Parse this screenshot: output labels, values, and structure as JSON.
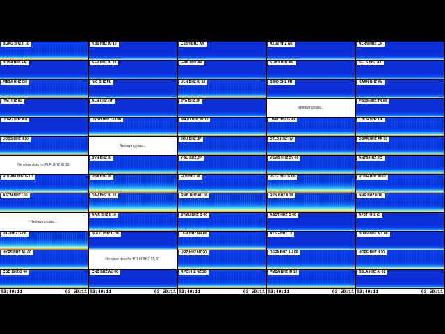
{
  "timestamps": {
    "start": "03:49:11",
    "end": "03:59:11"
  },
  "columns": [
    {
      "panels": [
        {
          "label": "BGKG BHZ II 10",
          "state": "data",
          "style": "normal"
        },
        {
          "label": "BOSA BHZ FM",
          "state": "data",
          "style": "calm"
        },
        {
          "label": "FIESA HHZ CH",
          "state": "data",
          "style": "normal"
        },
        {
          "label": "ITM HHZ HL",
          "state": "data",
          "style": "calm"
        },
        {
          "label": "DURG HHZ KO",
          "state": "data",
          "style": "calm"
        },
        {
          "label": "UOSS BHZ II 10",
          "state": "data",
          "style": "normal"
        },
        {
          "label": "",
          "state": "nodata",
          "message": "No wave data for FUR BHZ IU 10."
        },
        {
          "label": "ROCAM BHZ G 10",
          "state": "data",
          "style": "normal"
        },
        {
          "label": "ASCN BHZ I 00",
          "state": "data",
          "style": "normal"
        },
        {
          "label": "",
          "state": "loading",
          "message": "Retrieving data..."
        },
        {
          "label": "PAF BHZ G 00",
          "state": "data",
          "style": "hot"
        },
        {
          "label": "HKPS BHZ AU 00",
          "state": "data",
          "style": "normal"
        },
        {
          "label": "CGD BHZ G 00",
          "state": "data",
          "style": "normal"
        }
      ]
    },
    {
      "panels": [
        {
          "label": "KBS HHZ IU 10",
          "state": "data",
          "style": "calm"
        },
        {
          "label": "KEV BHZ IU 10",
          "state": "data",
          "style": "calm"
        },
        {
          "label": "NIC BHZ FL",
          "state": "data",
          "style": "calm"
        },
        {
          "label": "ALN HHZ HT",
          "state": "data",
          "style": "calm"
        },
        {
          "label": "DYNH HHZ GO 00",
          "state": "data",
          "style": "normal"
        },
        {
          "label": "",
          "state": "loading",
          "message": "Retrieving data..."
        },
        {
          "label": "SVN BHZ IU",
          "state": "data",
          "style": "normal"
        },
        {
          "label": "PBA HHZ IN",
          "state": "data",
          "style": "hot"
        },
        {
          "label": "DAV BHZ IU 10",
          "state": "data",
          "style": "hot"
        },
        {
          "label": "AIVR BHZ II 10",
          "state": "data",
          "style": "normal"
        },
        {
          "label": "NGUC HHZ G 00",
          "state": "data",
          "style": "calm"
        },
        {
          "label": "",
          "state": "nodata",
          "message": "No wave data for BTLM BHZ 20 00."
        },
        {
          "label": "CNB BHZ AU 00",
          "state": "data",
          "style": "calm"
        }
      ]
    },
    {
      "panels": [
        {
          "label": "C1BH BHZ AK",
          "state": "data",
          "style": "calm"
        },
        {
          "label": "GAN BHZ AV",
          "state": "data",
          "style": "calm"
        },
        {
          "label": "ULN BHZ IU 10",
          "state": "data",
          "style": "normal"
        },
        {
          "label": "JYA BHZ JP",
          "state": "data",
          "style": "calm"
        },
        {
          "label": "MAJO BHZ IU 10",
          "state": "data",
          "style": "normal"
        },
        {
          "label": "JOU BHZ JP",
          "state": "data",
          "style": "normal"
        },
        {
          "label": "YGU BHZ JP",
          "state": "data",
          "style": "normal"
        },
        {
          "label": "FLB BHZ MI",
          "state": "data",
          "style": "normal"
        },
        {
          "label": "RMB BHZ AU 00",
          "state": "data",
          "style": "hot"
        },
        {
          "label": "STMU BHZ G 00",
          "state": "data",
          "style": "normal"
        },
        {
          "label": "LEM HHZ NV 00",
          "state": "data",
          "style": "normal"
        },
        {
          "label": "URZ HHZ NZ 20",
          "state": "data",
          "style": "normal"
        },
        {
          "label": "RPZ HHZ NZ 20",
          "state": "data",
          "style": "normal"
        }
      ]
    },
    {
      "panels": [
        {
          "label": "A21N HHZ AK",
          "state": "data",
          "style": "calm"
        },
        {
          "label": "KOKV BHZ AV",
          "state": "data",
          "style": "calm"
        },
        {
          "label": "BB40 DHZ FB",
          "state": "data",
          "style": "calm"
        },
        {
          "label": "",
          "state": "loading",
          "message": "Retrieving data..."
        },
        {
          "label": "LINM HHZ G 00",
          "state": "data",
          "style": "normal"
        },
        {
          "label": "DTLD HHZ HV",
          "state": "data",
          "style": "normal"
        },
        {
          "label": "VSMG HHZ SV 00",
          "state": "data",
          "style": "normal"
        },
        {
          "label": "PFTF BHZ G 00",
          "state": "data",
          "style": "hot"
        },
        {
          "label": "RPN BHZ II 10",
          "state": "data",
          "style": "hot"
        },
        {
          "label": "AGST HHZ G 00",
          "state": "data",
          "style": "calm"
        },
        {
          "label": "AYSG HHZ CI",
          "state": "data",
          "style": "calm"
        },
        {
          "label": "DSPA BHZ AU 00",
          "state": "data",
          "style": "normal"
        },
        {
          "label": "PMSA BHZ IU 10",
          "state": "data",
          "style": "normal"
        }
      ]
    },
    {
      "panels": [
        {
          "label": "ALRN HHZ CN",
          "state": "data",
          "style": "calm"
        },
        {
          "label": "SELS BHZ AV",
          "state": "data",
          "style": "calm"
        },
        {
          "label": "KARN BHZ AV",
          "state": "data",
          "style": "calm"
        },
        {
          "label": "PBDS HHZ TX 00",
          "state": "data",
          "style": "calm"
        },
        {
          "label": "CHOR HHZ OK",
          "state": "data",
          "style": "normal"
        },
        {
          "label": "DBPR HHZ PR 00",
          "state": "data",
          "style": "normal"
        },
        {
          "label": "ANTS HHZ EC",
          "state": "data",
          "style": "normal"
        },
        {
          "label": "ROSR HHZ IU 02",
          "state": "data",
          "style": "normal"
        },
        {
          "label": "NNR BHZ II 10",
          "state": "data",
          "style": "normal"
        },
        {
          "label": "AP3T HHZ CI",
          "state": "data",
          "style": "calm"
        },
        {
          "label": "SOKV BHZ MY 00",
          "state": "data",
          "style": "calm"
        },
        {
          "label": "HOPE BHZ II 10",
          "state": "data",
          "style": "normal"
        },
        {
          "label": "BSLA HHZ AI 02",
          "state": "data",
          "style": "calm"
        }
      ]
    }
  ]
}
